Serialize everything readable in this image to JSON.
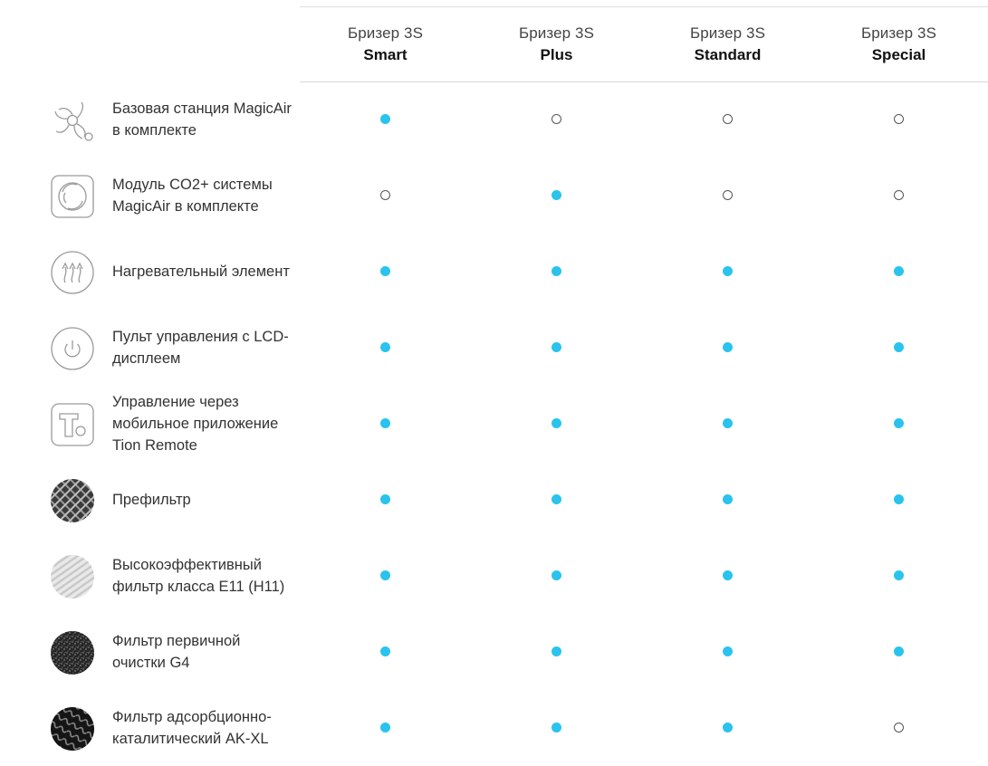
{
  "colors": {
    "accent": "#29c3ee",
    "text": "#333333",
    "divider": "#d8d8d8"
  },
  "models": [
    {
      "prefix": "Бризер 3S",
      "variant": "Smart"
    },
    {
      "prefix": "Бризер 3S",
      "variant": "Plus"
    },
    {
      "prefix": "Бризер 3S",
      "variant": "Standard"
    },
    {
      "prefix": "Бризер 3S",
      "variant": "Special"
    }
  ],
  "features": [
    {
      "icon": "magicair-base-station-icon",
      "label_lines": [
        "Базовая станция MagicAir",
        "в комплекте"
      ],
      "availability": [
        true,
        false,
        false,
        false
      ]
    },
    {
      "icon": "co2-module-icon",
      "label_lines": [
        "Модуль CO2+ системы",
        "MagicAir в комплекте"
      ],
      "availability": [
        false,
        true,
        false,
        false
      ]
    },
    {
      "icon": "heating-element-icon",
      "label_lines": [
        "Нагревательный элемент"
      ],
      "availability": [
        true,
        true,
        true,
        true
      ]
    },
    {
      "icon": "power-remote-icon",
      "label_lines": [
        "Пульт управления с LCD-",
        "дисплеем"
      ],
      "availability": [
        true,
        true,
        true,
        true
      ]
    },
    {
      "icon": "tion-app-icon",
      "label_lines": [
        "Управление через",
        "мобильное приложение",
        "Tion Remote"
      ],
      "availability": [
        true,
        true,
        true,
        true
      ]
    },
    {
      "icon": "prefilter-mesh-icon",
      "label_lines": [
        "Префильтр"
      ],
      "availability": [
        true,
        true,
        true,
        true
      ]
    },
    {
      "icon": "hepa-filter-icon",
      "label_lines": [
        "Высокоэффективный",
        "фильтр класса E11 (H11)"
      ],
      "availability": [
        true,
        true,
        true,
        true
      ]
    },
    {
      "icon": "g4-filter-icon",
      "label_lines": [
        "Фильтр первичной",
        "очистки G4"
      ],
      "availability": [
        true,
        true,
        true,
        true
      ]
    },
    {
      "icon": "carbon-filter-icon",
      "label_lines": [
        "Фильтр адсорбционно-",
        "каталитический AK-XL"
      ],
      "availability": [
        true,
        true,
        true,
        false
      ]
    }
  ]
}
